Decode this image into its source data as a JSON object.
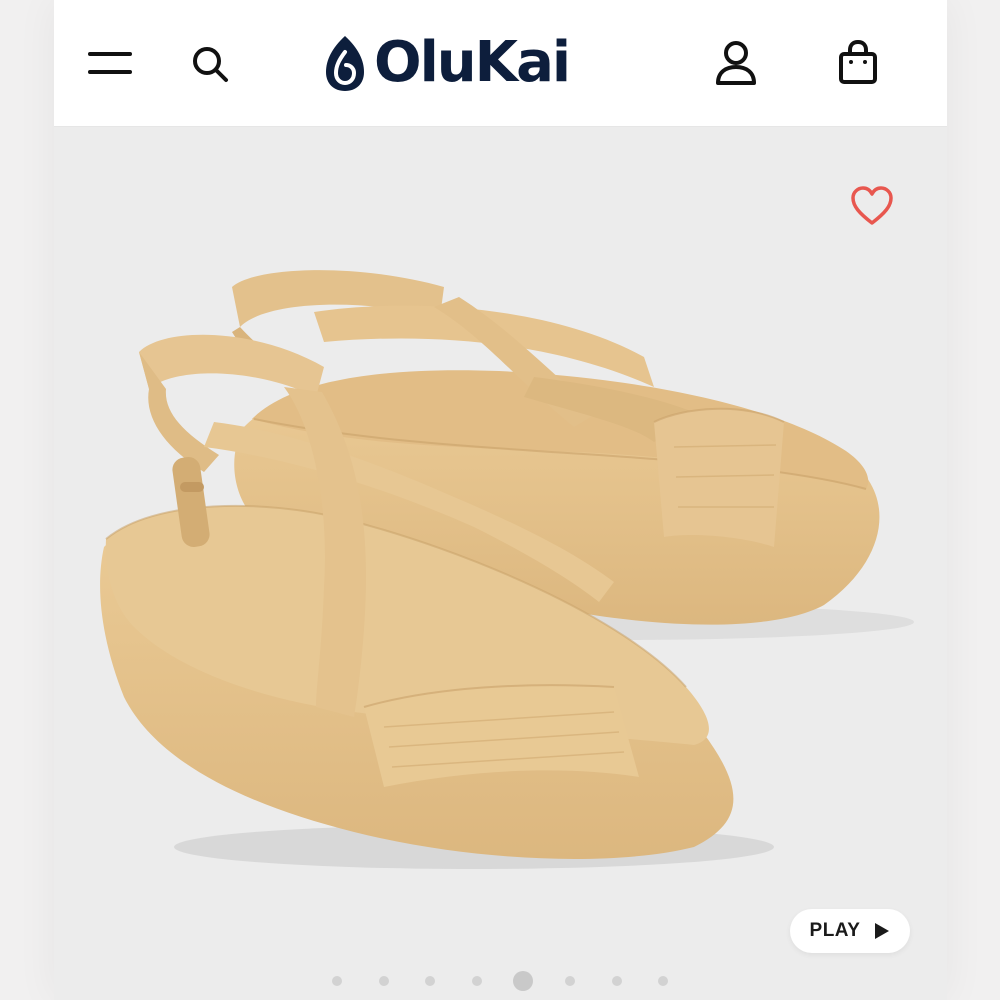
{
  "brand": {
    "name": "OluKai",
    "color": "#0d1e3c"
  },
  "header": {
    "icons": [
      "menu-icon",
      "search-icon",
      "account-icon",
      "bag-icon"
    ]
  },
  "gallery": {
    "favorite_icon": "heart-icon",
    "favorite_color": "#e8574f",
    "product_color": "#e5c590",
    "play_label": "PLAY",
    "play_icon": "play-icon",
    "slide_count": 8,
    "active_slide": 5
  }
}
